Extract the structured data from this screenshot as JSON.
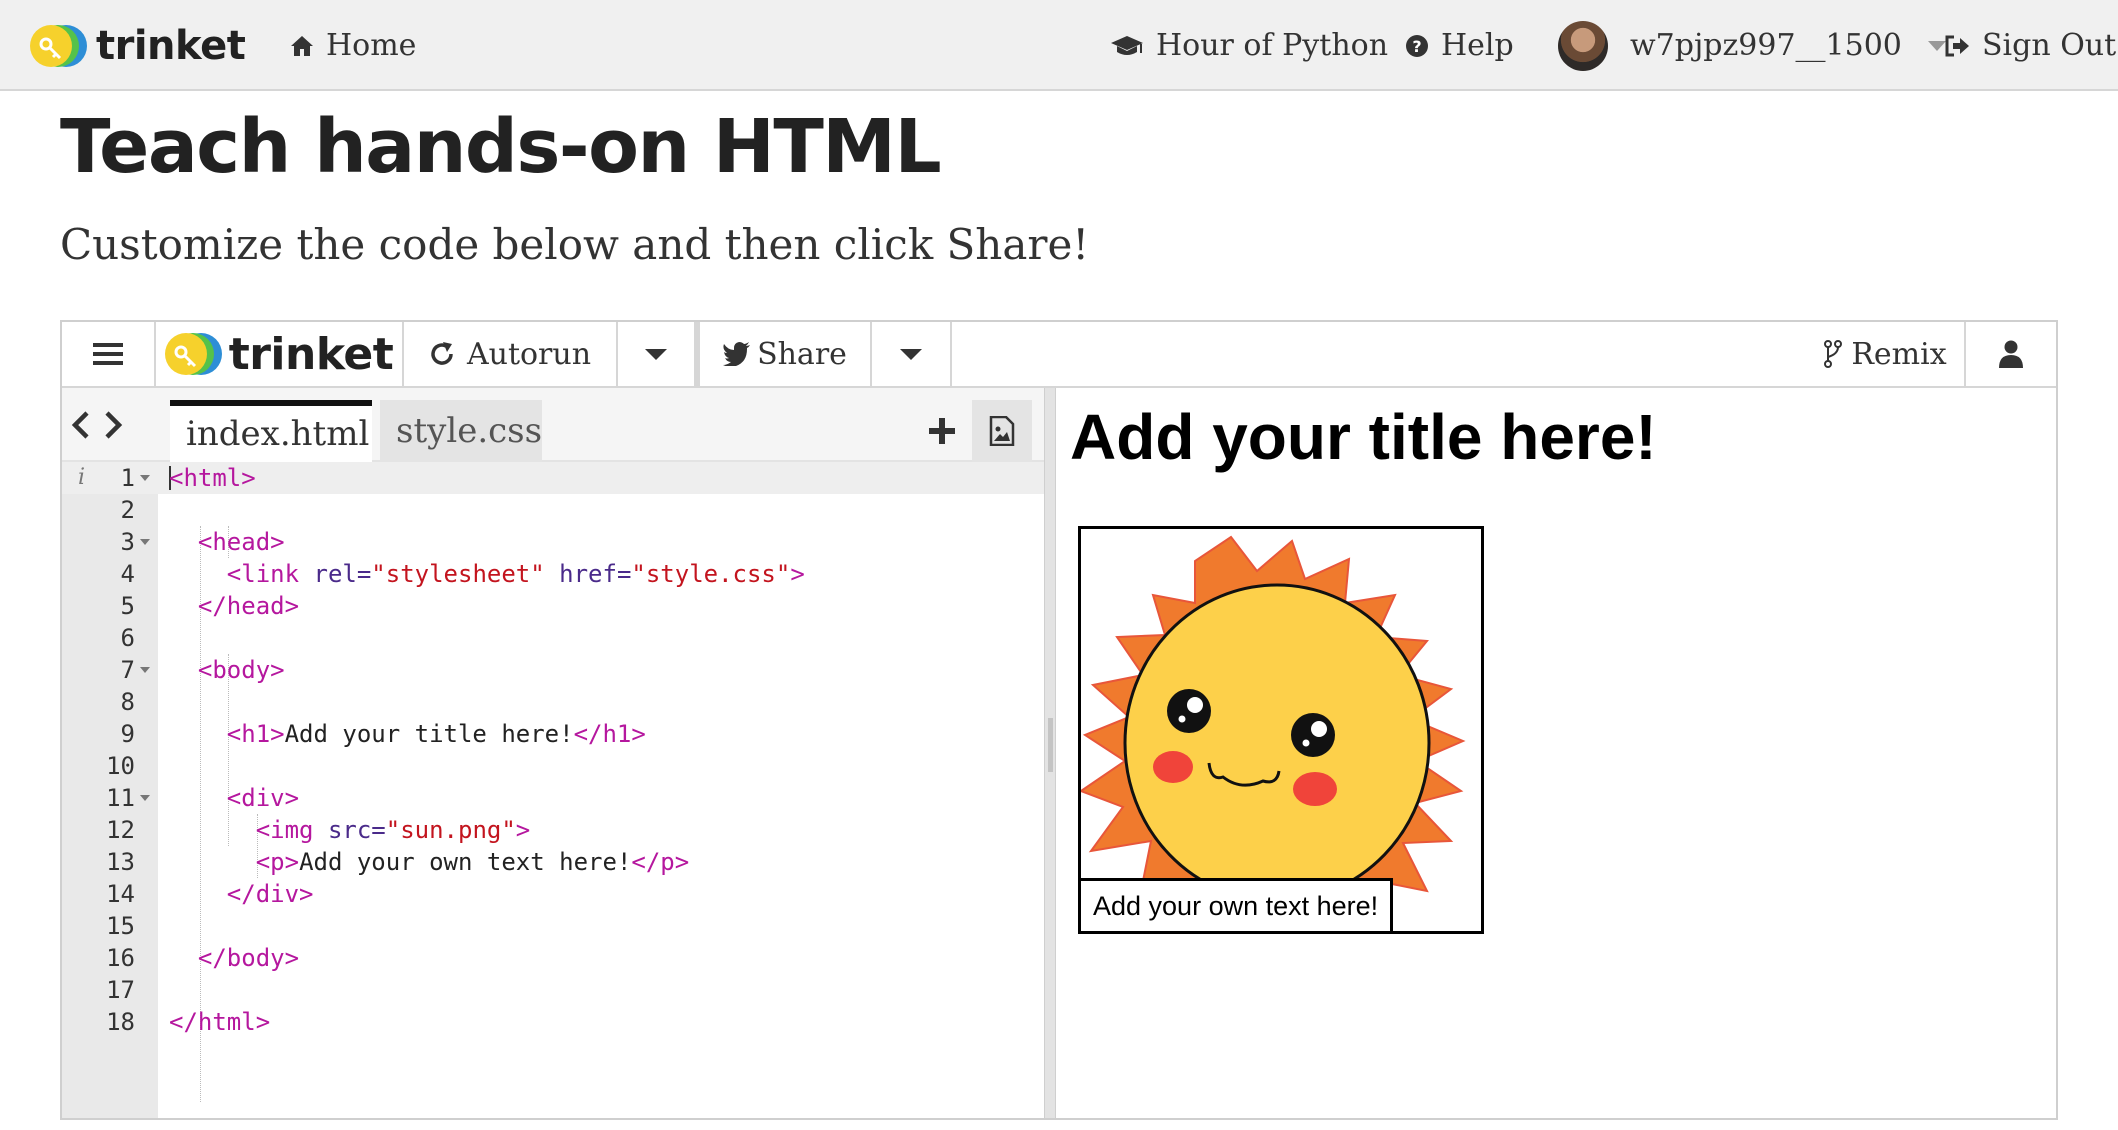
{
  "site": {
    "logo_text": "trinket",
    "nav": {
      "home": "Home",
      "hour_of_python": "Hour of Python",
      "help": "Help",
      "username": "w7pjpz997__1500",
      "sign_out": "Sign Out"
    }
  },
  "page": {
    "title": "Teach hands-on HTML",
    "subtitle": "Customize the code below and then click Share!"
  },
  "embed": {
    "logo_text": "trinket",
    "toolbar": {
      "autorun": "Autorun",
      "share": "Share",
      "remix": "Remix"
    },
    "tabs": [
      "index.html",
      "style.css"
    ],
    "active_tab": "index.html",
    "code_lines": [
      {
        "n": "1",
        "fold": true,
        "html": "<span class=\"tg\">&lt;html&gt;</span>"
      },
      {
        "n": "2",
        "fold": false,
        "html": ""
      },
      {
        "n": "3",
        "fold": true,
        "html": "  <span class=\"tg\">&lt;head&gt;</span>"
      },
      {
        "n": "4",
        "fold": false,
        "html": "    <span class=\"tg\">&lt;link</span> <span class=\"an\">rel=</span><span class=\"st\">\"stylesheet\"</span> <span class=\"an\">href=</span><span class=\"st\">\"style.css\"</span><span class=\"tg\">&gt;</span>"
      },
      {
        "n": "5",
        "fold": false,
        "html": "  <span class=\"tg\">&lt;/head&gt;</span>"
      },
      {
        "n": "6",
        "fold": false,
        "html": ""
      },
      {
        "n": "7",
        "fold": true,
        "html": "  <span class=\"tg\">&lt;body&gt;</span>"
      },
      {
        "n": "8",
        "fold": false,
        "html": ""
      },
      {
        "n": "9",
        "fold": false,
        "html": "    <span class=\"tg\">&lt;h1&gt;</span>Add your title here!<span class=\"tg\">&lt;/h1&gt;</span>"
      },
      {
        "n": "10",
        "fold": false,
        "html": ""
      },
      {
        "n": "11",
        "fold": true,
        "html": "    <span class=\"tg\">&lt;div&gt;</span>"
      },
      {
        "n": "12",
        "fold": false,
        "html": "      <span class=\"tg\">&lt;img</span> <span class=\"an\">src=</span><span class=\"st\">\"sun.png\"</span><span class=\"tg\">&gt;</span>"
      },
      {
        "n": "13",
        "fold": false,
        "html": "      <span class=\"tg\">&lt;p&gt;</span>Add your own text here!<span class=\"tg\">&lt;/p&gt;</span>"
      },
      {
        "n": "14",
        "fold": false,
        "html": "    <span class=\"tg\">&lt;/div&gt;</span>"
      },
      {
        "n": "15",
        "fold": false,
        "html": ""
      },
      {
        "n": "16",
        "fold": false,
        "html": "  <span class=\"tg\">&lt;/body&gt;</span>"
      },
      {
        "n": "17",
        "fold": false,
        "html": ""
      },
      {
        "n": "18",
        "fold": false,
        "html": "<span class=\"tg\">&lt;/html&gt;</span>"
      }
    ],
    "output": {
      "title": "Add your title here!",
      "text": "Add your own text here!"
    }
  },
  "colors": {
    "navbar_bg": "#f0f0f0",
    "tag": "#b5179e",
    "attribute": "#4a2a8a",
    "string": "#c3141e",
    "sun_rays": "#f07a2d",
    "sun_face": "#fdd04a",
    "cheeks": "#f0443a"
  },
  "icons": [
    "home-icon",
    "graduation-cap-icon",
    "question-circle-icon",
    "sign-out-icon",
    "hamburger-menu-icon",
    "refresh-icon",
    "twitter-icon",
    "fork-icon",
    "user-icon",
    "chevron-left-icon",
    "chevron-right-icon",
    "plus-icon",
    "image-icon"
  ]
}
